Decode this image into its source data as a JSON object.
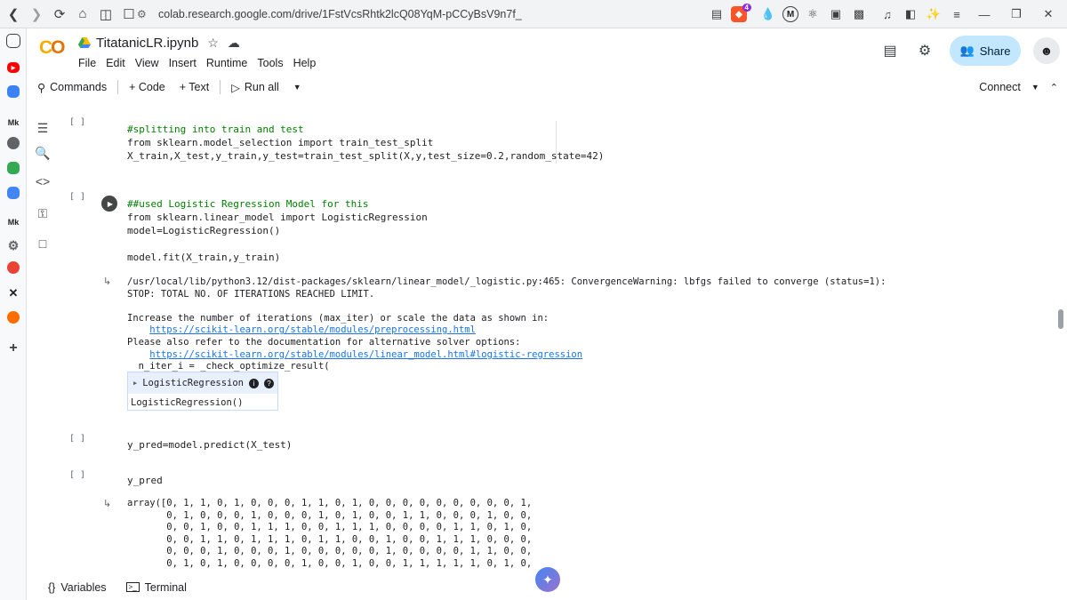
{
  "browser": {
    "url": "colab.research.google.com/drive/1FstVcsRhtk2lcQ08YqM-pCCyBsV9n7f_",
    "brave_badge": "4",
    "metamask_label": "M"
  },
  "header": {
    "logo": "CO",
    "title": "TitatanicLR.ipynb",
    "menu": [
      "File",
      "Edit",
      "View",
      "Insert",
      "Runtime",
      "Tools",
      "Help"
    ],
    "share_label": "Share"
  },
  "toolbar": {
    "commands": "Commands",
    "code": "+ Code",
    "text": "+ Text",
    "run_all": "Run all",
    "connect": "Connect"
  },
  "cells": [
    {
      "bracket": "[ ]",
      "lines": [
        "#splitting into train and test",
        "from sklearn.model_selection import train_test_split",
        "X_train,X_test,y_train,y_test=train_test_split(X,y,test_size=0.2,random_state=42)"
      ]
    },
    {
      "bracket": "[ ]",
      "lines": [
        "##used Logistic Regression Model for this",
        "from sklearn.linear_model import LogisticRegression",
        "model=LogisticRegression()",
        "",
        "model.fit(X_train,y_train)"
      ],
      "output": {
        "warning_1": "/usr/local/lib/python3.12/dist-packages/sklearn/linear_model/_logistic.py:465: ConvergenceWarning: lbfgs failed to converge (status=1):",
        "warning_2": "STOP: TOTAL NO. OF ITERATIONS REACHED LIMIT.",
        "warning_3": "Increase the number of iterations (max_iter) or scale the data as shown in:",
        "link_1": "https://scikit-learn.org/stable/modules/preprocessing.html",
        "warning_4": "Please also refer to the documentation for alternative solver options:",
        "link_2": "https://scikit-learn.org/stable/modules/linear_model.html#logistic-regression",
        "warning_5": "n_iter_i = _check_optimize_result(",
        "model_head": "LogisticRegression",
        "model_body": "LogisticRegression()"
      }
    },
    {
      "bracket": "[ ]",
      "lines": [
        "y_pred=model.predict(X_test)"
      ]
    },
    {
      "bracket": "[ ]",
      "lines": [
        "y_pred"
      ],
      "output_lines": [
        "array([0, 1, 1, 0, 1, 0, 0, 0, 1, 1, 0, 1, 0, 0, 0, 0, 0, 0, 0, 0, 0, 1,",
        "       0, 1, 0, 0, 0, 1, 0, 0, 0, 1, 0, 1, 0, 0, 1, 1, 0, 0, 0, 1, 0, 0,",
        "       0, 0, 1, 0, 0, 1, 1, 1, 0, 0, 1, 1, 1, 0, 0, 0, 0, 1, 1, 0, 1, 0,",
        "       0, 0, 1, 1, 0, 1, 1, 1, 0, 1, 1, 0, 0, 1, 0, 0, 1, 1, 1, 0, 0, 0,",
        "       0, 0, 0, 1, 0, 0, 0, 1, 0, 0, 0, 0, 0, 1, 0, 0, 0, 0, 1, 1, 0, 0,",
        "       0, 1, 0, 1, 0, 0, 0, 0, 1, 0, 0, 1, 0, 0, 1, 1, 1, 1, 1, 0, 1, 0,"
      ]
    }
  ],
  "bottom": {
    "variables": "Variables",
    "terminal": "Terminal"
  },
  "colors": {
    "accent": "#0b57d0",
    "share_bg": "#c2e7ff",
    "link": "#1a73e8"
  },
  "icons": [
    "back-icon",
    "forward-icon",
    "reload-icon",
    "home-icon",
    "split-icon",
    "bookmark-icon",
    "tune-icon",
    "reader-icon",
    "brave-icon",
    "drop-icon",
    "metamask-icon",
    "puzzle-icon",
    "extension-icon",
    "music-icon",
    "sidebar-icon",
    "sparkle-icon",
    "hamburger-icon",
    "star-icon",
    "cloud-icon",
    "comment-icon",
    "gear-icon",
    "search-icon",
    "play-icon",
    "chevron-down-icon",
    "chevron-up-icon",
    "toc-icon",
    "find-icon",
    "code-icon",
    "key-icon",
    "folder-icon",
    "braces-icon",
    "terminal-icon",
    "gemini-icon"
  ]
}
